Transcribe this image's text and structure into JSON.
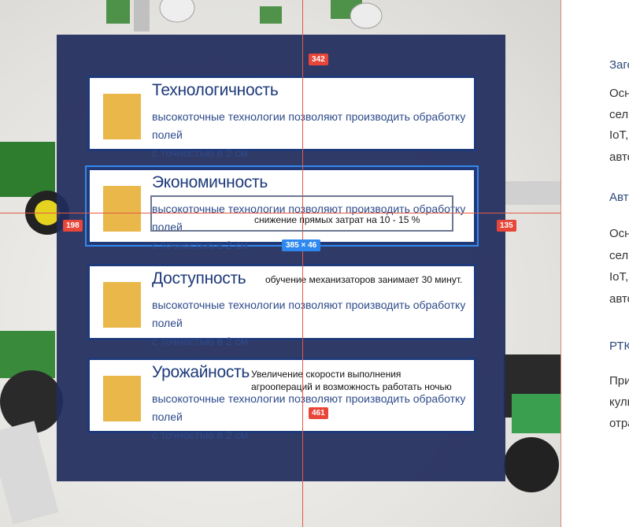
{
  "cards": [
    {
      "title": "Технологичность",
      "desc_line1": "высокоточные технологии позволяют производить обработку полей",
      "desc_line2": "с точностью в 2 см"
    },
    {
      "title": "Экономичность",
      "desc_line1": "высокоточные технологии позволяют производить обработку полей",
      "desc_line2": "с точностью в 2 см"
    },
    {
      "title": "Доступность",
      "desc_line1": "высокоточные технологии позволяют производить обработку полей",
      "desc_line2": "с точностью в 2 см"
    },
    {
      "title": "Урожайность",
      "desc_line1": "высокоточные технологии позволяют производить обработку полей",
      "desc_line2": "с точностью в 2 см"
    }
  ],
  "notes": {
    "economy": "снижение прямых затрат на 10 - 15 %",
    "access": "обучение механизаторов занимает 30 минут.",
    "yield_line1": "Увеличение скорости выполнения",
    "yield_line2": "агроопераций и возможность работать ночью"
  },
  "measure": {
    "top": "342",
    "left": "198",
    "right": "135",
    "bottom": "461",
    "size": "385 × 46"
  },
  "right_column": {
    "items": [
      "Загс",
      "Осн",
      "сель",
      "IoT,",
      "авто",
      "Авто",
      "Осн",
      "сель",
      "IoT,",
      "авто",
      "РТК",
      "При",
      "куль",
      "отра"
    ]
  },
  "colors": {
    "overlay": "#212c5c",
    "card_border": "#1e3a7a",
    "swatch": "#eab84a",
    "guide": "#e25a45",
    "selection": "#2f88f0"
  }
}
